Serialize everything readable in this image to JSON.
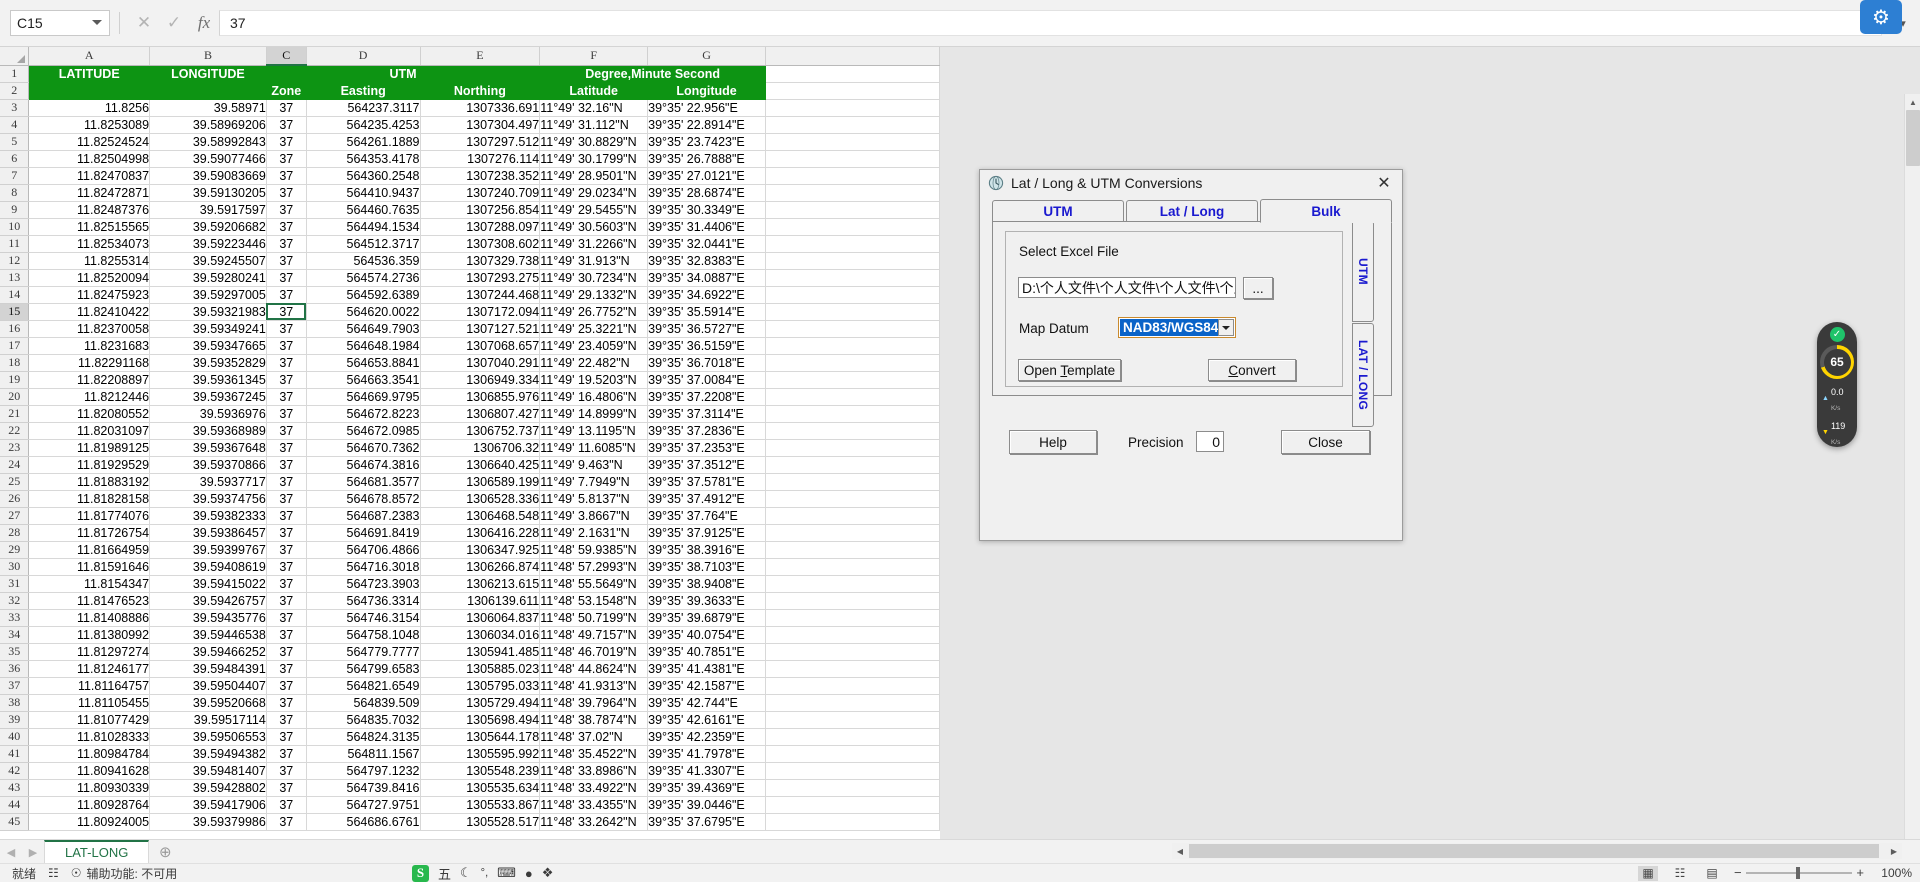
{
  "formula_bar": {
    "name_box_value": "C15",
    "formula_value": "37",
    "cancel_icon": "close-icon",
    "confirm_icon": "check-icon",
    "fx_label": "fx"
  },
  "sheet": {
    "column_headers": [
      "A",
      "B",
      "C",
      "D",
      "E",
      "F",
      "G"
    ],
    "selected_column": "C",
    "selected_row": 15,
    "header_row1": [
      {
        "text": "LATITUDE",
        "span": 1
      },
      {
        "text": "LONGITUDE",
        "span": 1
      },
      {
        "text": "UTM",
        "span": 3
      },
      {
        "text": "Degree,Minute Second",
        "span": 2
      }
    ],
    "header_row2": [
      "",
      "",
      "Zone",
      "Easting",
      "Northing",
      "Latitude",
      "Longitude"
    ],
    "rows": [
      {
        "n": 3,
        "a": "11.8256",
        "b": "39.58971",
        "c": "37",
        "d": "564237.3117",
        "e": "1307336.691",
        "f": "11°49' 32.16\"N",
        "g": "39°35' 22.956\"E"
      },
      {
        "n": 4,
        "a": "11.8253089",
        "b": "39.58969206",
        "c": "37",
        "d": "564235.4253",
        "e": "1307304.497",
        "f": "11°49' 31.112\"N",
        "g": "39°35' 22.8914\"E"
      },
      {
        "n": 5,
        "a": "11.82524524",
        "b": "39.58992843",
        "c": "37",
        "d": "564261.1889",
        "e": "1307297.512",
        "f": "11°49' 30.8829\"N",
        "g": "39°35' 23.7423\"E"
      },
      {
        "n": 6,
        "a": "11.82504998",
        "b": "39.59077466",
        "c": "37",
        "d": "564353.4178",
        "e": "1307276.114",
        "f": "11°49' 30.1799\"N",
        "g": "39°35' 26.7888\"E"
      },
      {
        "n": 7,
        "a": "11.82470837",
        "b": "39.59083669",
        "c": "37",
        "d": "564360.2548",
        "e": "1307238.352",
        "f": "11°49' 28.9501\"N",
        "g": "39°35' 27.0121\"E"
      },
      {
        "n": 8,
        "a": "11.82472871",
        "b": "39.59130205",
        "c": "37",
        "d": "564410.9437",
        "e": "1307240.709",
        "f": "11°49' 29.0234\"N",
        "g": "39°35' 28.6874\"E"
      },
      {
        "n": 9,
        "a": "11.82487376",
        "b": "39.5917597",
        "c": "37",
        "d": "564460.7635",
        "e": "1307256.854",
        "f": "11°49' 29.5455\"N",
        "g": "39°35' 30.3349\"E"
      },
      {
        "n": 10,
        "a": "11.82515565",
        "b": "39.59206682",
        "c": "37",
        "d": "564494.1534",
        "e": "1307288.097",
        "f": "11°49' 30.5603\"N",
        "g": "39°35' 31.4406\"E"
      },
      {
        "n": 11,
        "a": "11.82534073",
        "b": "39.59223446",
        "c": "37",
        "d": "564512.3717",
        "e": "1307308.602",
        "f": "11°49' 31.2266\"N",
        "g": "39°35' 32.0441\"E"
      },
      {
        "n": 12,
        "a": "11.8255314",
        "b": "39.59245507",
        "c": "37",
        "d": "564536.359",
        "e": "1307329.738",
        "f": "11°49' 31.913\"N",
        "g": "39°35' 32.8383\"E"
      },
      {
        "n": 13,
        "a": "11.82520094",
        "b": "39.59280241",
        "c": "37",
        "d": "564574.2736",
        "e": "1307293.275",
        "f": "11°49' 30.7234\"N",
        "g": "39°35' 34.0887\"E"
      },
      {
        "n": 14,
        "a": "11.82475923",
        "b": "39.59297005",
        "c": "37",
        "d": "564592.6389",
        "e": "1307244.468",
        "f": "11°49' 29.1332\"N",
        "g": "39°35' 34.6922\"E"
      },
      {
        "n": 15,
        "a": "11.82410422",
        "b": "39.59321983",
        "c": "37",
        "d": "564620.0022",
        "e": "1307172.094",
        "f": "11°49' 26.7752\"N",
        "g": "39°35' 35.5914\"E"
      },
      {
        "n": 16,
        "a": "11.82370058",
        "b": "39.59349241",
        "c": "37",
        "d": "564649.7903",
        "e": "1307127.521",
        "f": "11°49' 25.3221\"N",
        "g": "39°35' 36.5727\"E"
      },
      {
        "n": 17,
        "a": "11.8231683",
        "b": "39.59347665",
        "c": "37",
        "d": "564648.1984",
        "e": "1307068.657",
        "f": "11°49' 23.4059\"N",
        "g": "39°35' 36.5159\"E"
      },
      {
        "n": 18,
        "a": "11.82291168",
        "b": "39.59352829",
        "c": "37",
        "d": "564653.8841",
        "e": "1307040.291",
        "f": "11°49' 22.482\"N",
        "g": "39°35' 36.7018\"E"
      },
      {
        "n": 19,
        "a": "11.82208897",
        "b": "39.59361345",
        "c": "37",
        "d": "564663.3541",
        "e": "1306949.334",
        "f": "11°49' 19.5203\"N",
        "g": "39°35' 37.0084\"E"
      },
      {
        "n": 20,
        "a": "11.8212446",
        "b": "39.59367245",
        "c": "37",
        "d": "564669.9795",
        "e": "1306855.976",
        "f": "11°49' 16.4806\"N",
        "g": "39°35' 37.2208\"E"
      },
      {
        "n": 21,
        "a": "11.82080552",
        "b": "39.5936976",
        "c": "37",
        "d": "564672.8223",
        "e": "1306807.427",
        "f": "11°49' 14.8999\"N",
        "g": "39°35' 37.3114\"E"
      },
      {
        "n": 22,
        "a": "11.82031097",
        "b": "39.59368989",
        "c": "37",
        "d": "564672.0985",
        "e": "1306752.737",
        "f": "11°49' 13.1195\"N",
        "g": "39°35' 37.2836\"E"
      },
      {
        "n": 23,
        "a": "11.81989125",
        "b": "39.59367648",
        "c": "37",
        "d": "564670.7362",
        "e": "1306706.32",
        "f": "11°49' 11.6085\"N",
        "g": "39°35' 37.2353\"E"
      },
      {
        "n": 24,
        "a": "11.81929529",
        "b": "39.59370866",
        "c": "37",
        "d": "564674.3816",
        "e": "1306640.425",
        "f": "11°49' 9.463\"N",
        "g": "39°35' 37.3512\"E"
      },
      {
        "n": 25,
        "a": "11.81883192",
        "b": "39.5937717",
        "c": "37",
        "d": "564681.3577",
        "e": "1306589.199",
        "f": "11°49' 7.7949\"N",
        "g": "39°35' 37.5781\"E"
      },
      {
        "n": 26,
        "a": "11.81828158",
        "b": "39.59374756",
        "c": "37",
        "d": "564678.8572",
        "e": "1306528.336",
        "f": "11°49' 5.8137\"N",
        "g": "39°35' 37.4912\"E"
      },
      {
        "n": 27,
        "a": "11.81774076",
        "b": "39.59382333",
        "c": "37",
        "d": "564687.2383",
        "e": "1306468.548",
        "f": "11°49' 3.8667\"N",
        "g": "39°35' 37.764\"E"
      },
      {
        "n": 28,
        "a": "11.81726754",
        "b": "39.59386457",
        "c": "37",
        "d": "564691.8419",
        "e": "1306416.228",
        "f": "11°49' 2.1631\"N",
        "g": "39°35' 37.9125\"E"
      },
      {
        "n": 29,
        "a": "11.81664959",
        "b": "39.59399767",
        "c": "37",
        "d": "564706.4866",
        "e": "1306347.925",
        "f": "11°48' 59.9385\"N",
        "g": "39°35' 38.3916\"E"
      },
      {
        "n": 30,
        "a": "11.81591646",
        "b": "39.59408619",
        "c": "37",
        "d": "564716.3018",
        "e": "1306266.874",
        "f": "11°48' 57.2993\"N",
        "g": "39°35' 38.7103\"E"
      },
      {
        "n": 31,
        "a": "11.8154347",
        "b": "39.59415022",
        "c": "37",
        "d": "564723.3903",
        "e": "1306213.615",
        "f": "11°48' 55.5649\"N",
        "g": "39°35' 38.9408\"E"
      },
      {
        "n": 32,
        "a": "11.81476523",
        "b": "39.59426757",
        "c": "37",
        "d": "564736.3314",
        "e": "1306139.611",
        "f": "11°48' 53.1548\"N",
        "g": "39°35' 39.3633\"E"
      },
      {
        "n": 33,
        "a": "11.81408886",
        "b": "39.59435776",
        "c": "37",
        "d": "564746.3154",
        "e": "1306064.837",
        "f": "11°48' 50.7199\"N",
        "g": "39°35' 39.6879\"E"
      },
      {
        "n": 34,
        "a": "11.81380992",
        "b": "39.59446538",
        "c": "37",
        "d": "564758.1048",
        "e": "1306034.016",
        "f": "11°48' 49.7157\"N",
        "g": "39°35' 40.0754\"E"
      },
      {
        "n": 35,
        "a": "11.81297274",
        "b": "39.59466252",
        "c": "37",
        "d": "564779.7777",
        "e": "1305941.485",
        "f": "11°48' 46.7019\"N",
        "g": "39°35' 40.7851\"E"
      },
      {
        "n": 36,
        "a": "11.81246177",
        "b": "39.59484391",
        "c": "37",
        "d": "564799.6583",
        "e": "1305885.023",
        "f": "11°48' 44.8624\"N",
        "g": "39°35' 41.4381\"E"
      },
      {
        "n": 37,
        "a": "11.81164757",
        "b": "39.59504407",
        "c": "37",
        "d": "564821.6549",
        "e": "1305795.033",
        "f": "11°48' 41.9313\"N",
        "g": "39°35' 42.1587\"E"
      },
      {
        "n": 38,
        "a": "11.81105455",
        "b": "39.59520668",
        "c": "37",
        "d": "564839.509",
        "e": "1305729.494",
        "f": "11°48' 39.7964\"N",
        "g": "39°35' 42.744\"E"
      },
      {
        "n": 39,
        "a": "11.81077429",
        "b": "39.59517114",
        "c": "37",
        "d": "564835.7032",
        "e": "1305698.494",
        "f": "11°48' 38.7874\"N",
        "g": "39°35' 42.6161\"E"
      },
      {
        "n": 40,
        "a": "11.81028333",
        "b": "39.59506553",
        "c": "37",
        "d": "564824.3135",
        "e": "1305644.178",
        "f": "11°48' 37.02\"N",
        "g": "39°35' 42.2359\"E"
      },
      {
        "n": 41,
        "a": "11.80984784",
        "b": "39.59494382",
        "c": "37",
        "d": "564811.1567",
        "e": "1305595.992",
        "f": "11°48' 35.4522\"N",
        "g": "39°35' 41.7978\"E"
      },
      {
        "n": 42,
        "a": "11.80941628",
        "b": "39.59481407",
        "c": "37",
        "d": "564797.1232",
        "e": "1305548.239",
        "f": "11°48' 33.8986\"N",
        "g": "39°35' 41.3307\"E"
      },
      {
        "n": 43,
        "a": "11.80930339",
        "b": "39.59428802",
        "c": "37",
        "d": "564739.8416",
        "e": "1305535.634",
        "f": "11°48' 33.4922\"N",
        "g": "39°35' 39.4369\"E"
      },
      {
        "n": 44,
        "a": "11.80928764",
        "b": "39.59417906",
        "c": "37",
        "d": "564727.9751",
        "e": "1305533.867",
        "f": "11°48' 33.4355\"N",
        "g": "39°35' 39.0446\"E"
      },
      {
        "n": 45,
        "a": "11.80924005",
        "b": "39.59379986",
        "c": "37",
        "d": "564686.6761",
        "e": "1305528.517",
        "f": "11°48' 33.2642\"N",
        "g": "39°35' 37.6795\"E"
      }
    ]
  },
  "sheet_tabs": {
    "tabs": [
      "LAT-LONG"
    ],
    "add_sheet_icon": "plus-circle-icon",
    "prev_icon": "chevron-left-icon",
    "next_icon": "chevron-right-icon"
  },
  "status_bar": {
    "ready_text": "就绪",
    "accessibility_text": "辅助功能: 不可用",
    "zoom_level": "100%",
    "view_normal_icon": "normal-view-icon",
    "view_layout_icon": "page-layout-icon",
    "view_pagebreak_icon": "page-break-icon",
    "zoom_out_label": "−",
    "zoom_in_label": "+"
  },
  "ime_bar": {
    "logo_text": "S",
    "items": [
      "五",
      "moon-icon",
      "punctuation-icon",
      "keyboard-icon",
      "user-icon",
      "toolbox-icon"
    ]
  },
  "dialog": {
    "title": "Lat / Long & UTM Conversions",
    "title_icon": "globe-clock-icon",
    "close_icon": "close-icon",
    "tabs": [
      {
        "label": "UTM",
        "active": false
      },
      {
        "label": "Lat / Long",
        "active": false
      },
      {
        "label": "Bulk",
        "active": true
      }
    ],
    "group_label": "Select Excel File",
    "file_path": "D:\\个人文件\\个人文件\\个人文件\\个人文",
    "browse_label": "...",
    "map_datum_label": "Map Datum",
    "map_datum_value": "NAD83/WGS84",
    "open_template_label": "Open Template",
    "open_template_accel": "T",
    "convert_label": "Convert",
    "convert_accel": "C",
    "vertical_tabs": [
      {
        "label": "UTM"
      },
      {
        "label": "LAT / LONG"
      }
    ],
    "help_label": "Help",
    "help_accel": "H",
    "precision_label": "Precision",
    "precision_value": "0",
    "close_label": "Close",
    "close_accel": "C"
  },
  "net_widget": {
    "status_icon": "check-icon",
    "gauge_value": "65",
    "gauge_unit": "%",
    "up_value": "0.0",
    "up_unit": "K/s",
    "down_value": "119",
    "down_unit": "K/s"
  },
  "top_right_logo": {
    "icon": "app-logo-icon"
  },
  "colors": {
    "header_green": "#0d9413",
    "excel_green": "#217346",
    "tab_blue": "#1a19cf",
    "select_blue": "#0a63c8"
  }
}
